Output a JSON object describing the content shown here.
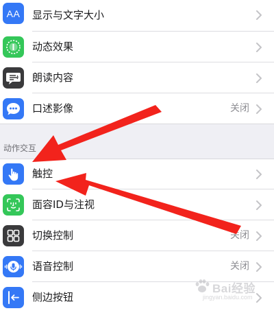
{
  "colors": {
    "background": "#efeff4",
    "blue": "#3478f6",
    "green": "#34c759",
    "dark_gray": "#3a3a3c",
    "arrow_red": "#f2231c",
    "text_primary": "#1c1c1e",
    "text_secondary": "#8e8e93"
  },
  "top_group": {
    "items": [
      {
        "label": "显示与文字大小",
        "value": "",
        "icon": "text-size-icon",
        "icon_text": "AA"
      },
      {
        "label": "动态效果",
        "value": "",
        "icon": "motion-icon"
      },
      {
        "label": "朗读内容",
        "value": "",
        "icon": "spoken-content-icon"
      },
      {
        "label": "口述影像",
        "value": "关闭",
        "icon": "audio-descriptions-icon"
      }
    ]
  },
  "interaction_section": {
    "header": "动作交互",
    "items": [
      {
        "label": "触控",
        "value": "",
        "icon": "touch-hand-icon"
      },
      {
        "label": "面容ID与注视",
        "value": "",
        "icon": "face-id-icon"
      },
      {
        "label": "切换控制",
        "value": "关闭",
        "icon": "switch-control-icon"
      },
      {
        "label": "语音控制",
        "value": "关闭",
        "icon": "voice-control-icon"
      },
      {
        "label": "侧边按钮",
        "value": "",
        "icon": "side-button-icon"
      }
    ]
  },
  "watermark": {
    "text": "Bai经验",
    "subtext": "jingyan.baidu.com"
  }
}
